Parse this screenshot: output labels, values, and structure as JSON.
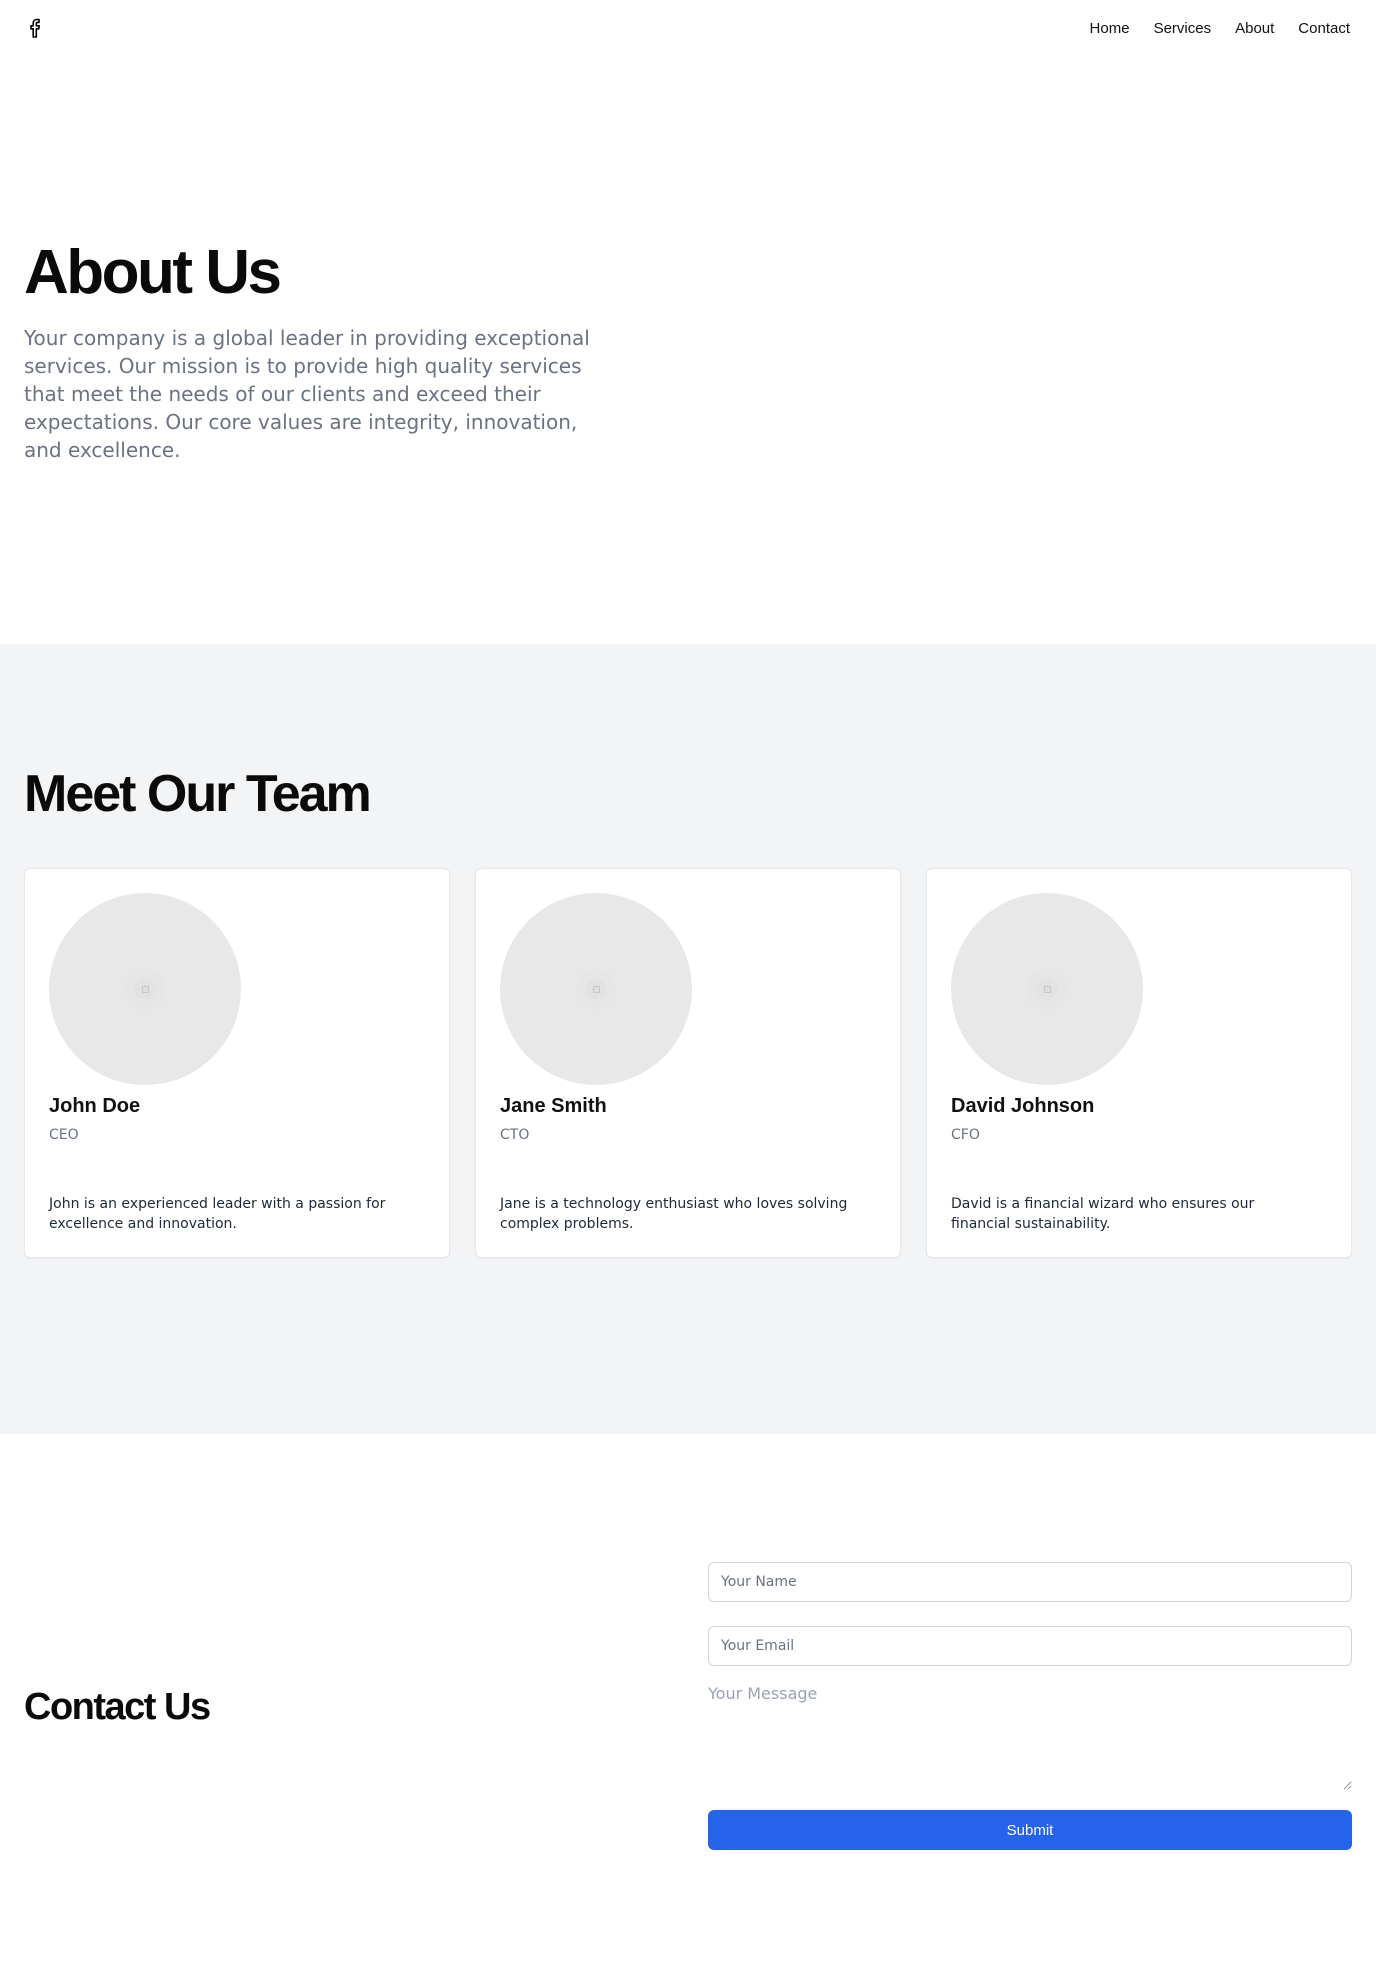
{
  "header": {
    "logo_icon": "facebook-icon",
    "nav": [
      {
        "label": "Home"
      },
      {
        "label": "Services"
      },
      {
        "label": "About"
      },
      {
        "label": "Contact"
      }
    ]
  },
  "about": {
    "title": "About Us",
    "description": "Your company is a global leader in providing exceptional services. Our mission is to provide high quality services that meet the needs of our clients and exceed their expectations. Our core values are integrity, innovation, and excellence."
  },
  "team": {
    "title": "Meet Our Team",
    "members": [
      {
        "name": "John Doe",
        "role": "CEO",
        "bio": "John is an experienced leader with a passion for excellence and innovation.",
        "avatar_icon": "image-placeholder-icon"
      },
      {
        "name": "Jane Smith",
        "role": "CTO",
        "bio": "Jane is a technology enthusiast who loves solving complex problems.",
        "avatar_icon": "image-placeholder-icon"
      },
      {
        "name": "David Johnson",
        "role": "CFO",
        "bio": "David is a financial wizard who ensures our financial sustainability.",
        "avatar_icon": "image-placeholder-icon"
      }
    ]
  },
  "contact": {
    "title": "Contact Us",
    "name_placeholder": "Your Name",
    "email_placeholder": "Your Email",
    "message_placeholder": "Your Message",
    "submit_label": "Submit"
  },
  "colors": {
    "accent": "#2563eb",
    "team_background": "#f3f4f6",
    "muted_text": "#6b7280"
  }
}
